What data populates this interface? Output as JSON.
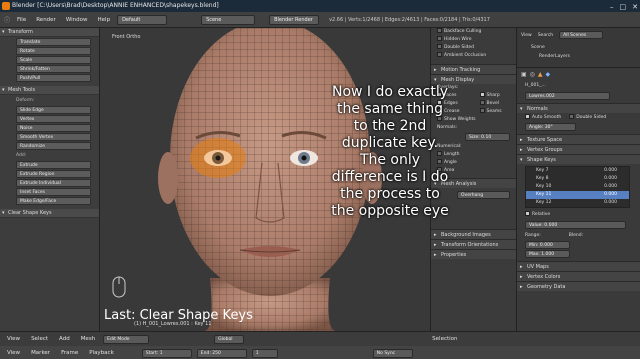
{
  "titlebar": {
    "title": "Blender [C:\\Users\\Brad\\Desktop\\ANNIE ENHANCED\\shapekeys.blend]"
  },
  "infobar": {
    "menus": [
      "File",
      "Render",
      "Window",
      "Help"
    ],
    "screen": "Default",
    "scene": "Scene",
    "engine": "Blender Render",
    "stats": "v2.66 | Verts:1/2468 | Edges:2/4613 | Faces:0/2184 | Tris:0/4317"
  },
  "toolshelf": {
    "transform_header": "Transform",
    "transform_tools": [
      "Translate",
      "Rotate",
      "Scale",
      "Shrink/Fatten",
      "Push/Pull"
    ],
    "mesh_tools_header": "Mesh Tools",
    "deform_label": "Deform:",
    "deform_tools": [
      "Slide Edge",
      "Vertex",
      "Noise",
      "Smooth Vertex",
      "Randomize"
    ],
    "add_label": "Add:",
    "add_tools": [
      "Extrude",
      "Extrude Region",
      "Extrude Individual",
      "Inset Faces",
      "Make Edge/Face"
    ],
    "op_header": "Clear Shape Keys"
  },
  "viewport": {
    "view_label": "Front Ortho",
    "last_operation": "Last: Clear Shape Keys",
    "object_label": "(1) H_001_Lowres.001 : Key 11"
  },
  "caption": {
    "text": "Now I do exactly the same thing to the 2nd duplicate key. The only difference is I do the process to the opposite eye"
  },
  "midpanel": {
    "rows": [
      "Backface Culling",
      "Hidden Wire",
      "Double Sided",
      "Ambient Occlusion"
    ],
    "motion_tracking": "Motion Tracking",
    "mesh_display": "Mesh Display",
    "overlay_label": "Overlays:",
    "overlay_items": [
      "Faces",
      "Edges",
      "Crease",
      "Sharp",
      "Bevel",
      "Seams"
    ],
    "normals_label": "Normals:",
    "show_weights": "Show Weights",
    "size_field": "Size: 0.10",
    "numerical_label": "Numerical:",
    "numerical_items": [
      "Length",
      "Angle",
      "Area"
    ],
    "mesh_analysis": "Mesh Analysis",
    "overhang_label": "Overhang",
    "background_images": "Background Images",
    "transform_orientations": "Transform Orientations",
    "properties": "Properties"
  },
  "outliner": {
    "items": [
      "View",
      "Search",
      "All Scenes",
      "Scene",
      "RenderLayers",
      "World"
    ]
  },
  "props": {
    "object_name": "H_001_...",
    "data_name": "Lowres.002",
    "normals_header": "Normals",
    "auto_smooth": "Auto Smooth",
    "double_sided": "Double Sided",
    "angle_field": "Angle: 30°",
    "texture_space": "Texture Space",
    "vertex_groups": "Vertex Groups",
    "shape_keys_header": "Shape Keys",
    "shape_keys": [
      {
        "name": "Key 7",
        "value": "0.000"
      },
      {
        "name": "Key 8",
        "value": "0.000"
      },
      {
        "name": "Key 10",
        "value": "0.000"
      },
      {
        "name": "Key 11",
        "value": "0.000"
      },
      {
        "name": "Key 12",
        "value": "0.000"
      }
    ],
    "active_key_index": 3,
    "relative_label": "Relative",
    "value_field": "Value: 0.000",
    "range_label": "Range:",
    "blend_label": "Blend:",
    "min_field": "Min: 0.000",
    "max_field": "Max: 1.000",
    "uv_maps": "UV Maps",
    "vertex_colors": "Vertex Colors",
    "geometry_data": "Geometry Data"
  },
  "timeline": {
    "menus": [
      "View",
      "Marker",
      "Frame",
      "Playback"
    ],
    "start_field": "Start: 1",
    "end_field": "End: 250",
    "current_frame": "1",
    "keying": "No Sync",
    "view_menus": [
      "View",
      "Select",
      "Add",
      "Mesh"
    ],
    "mode": "Edit Mode",
    "pivot": "Global",
    "layers_label": "Selection"
  },
  "colors": {
    "accent_orange": "#e87d0d",
    "active_blue": "#5680c2",
    "skin": "#b98a76"
  }
}
